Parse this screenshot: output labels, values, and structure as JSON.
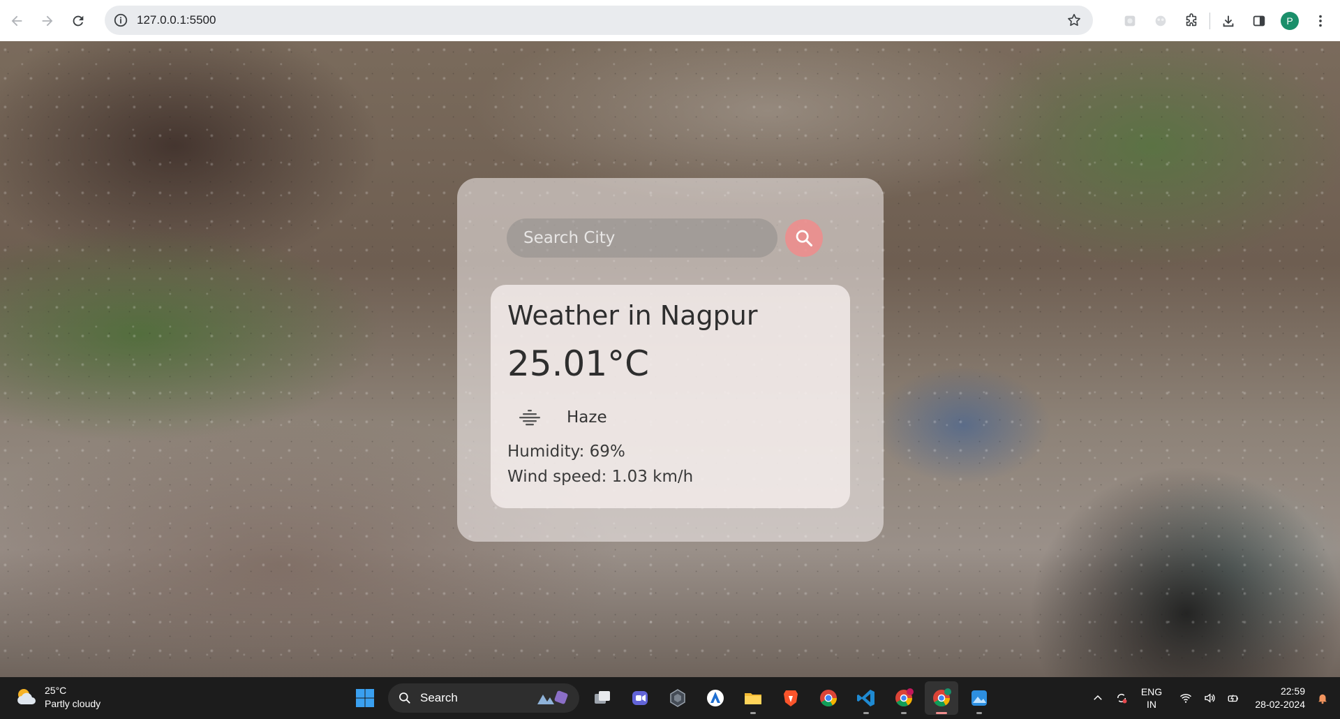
{
  "browser": {
    "url": "127.0.0.1:5500",
    "profile_initial": "P"
  },
  "app": {
    "search": {
      "placeholder": "Search City"
    },
    "weather": {
      "city_line": "Weather in Nagpur",
      "temperature": "25.01°C",
      "condition_icon": "haze-icon",
      "condition": "Haze",
      "humidity": "Humidity: 69%",
      "wind": "Wind speed: 1.03 km/h"
    }
  },
  "taskbar": {
    "weather": {
      "temp": "25°C",
      "desc": "Partly cloudy"
    },
    "search_label": "Search",
    "apps": [
      "start-icon",
      "task-view-icon",
      "teams-icon",
      "app-icon",
      "azure-data-studio-icon",
      "file-explorer-icon",
      "brave-icon",
      "chrome-icon",
      "vscode-icon",
      "chrome-profile-icon",
      "chrome-active-icon",
      "photos-icon"
    ],
    "tray": {
      "lang_top": "ENG",
      "lang_bottom": "IN",
      "time": "22:59",
      "date": "28-02-2024"
    }
  },
  "colors": {
    "search_button": "#f08c8c",
    "profile": "#1a8f6a"
  }
}
